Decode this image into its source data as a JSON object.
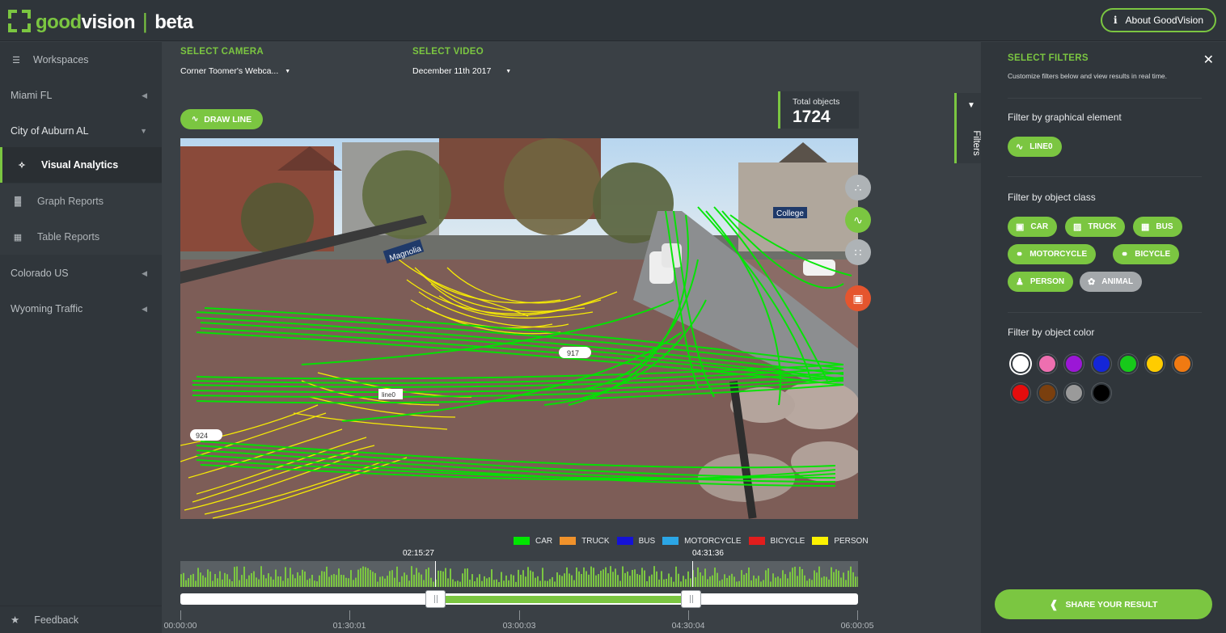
{
  "app": {
    "logo_good": "good",
    "logo_vision": "vision",
    "logo_sep": "|",
    "logo_beta": "beta",
    "about_label": "About GoodVision"
  },
  "sidebar": {
    "items": [
      {
        "label": "Workspaces",
        "icon": "list-icon"
      },
      {
        "label": "Miami FL",
        "icon": "chevron-left-icon"
      },
      {
        "label": "City of Auburn AL",
        "icon": "chevron-down-icon"
      },
      {
        "label": "Visual Analytics",
        "icon": "crosshair-icon"
      },
      {
        "label": "Graph Reports",
        "icon": "bar-chart-icon"
      },
      {
        "label": "Table Reports",
        "icon": "table-icon"
      },
      {
        "label": "Colorado US",
        "icon": "chevron-left-icon"
      },
      {
        "label": "Wyoming Traffic",
        "icon": "chevron-left-icon"
      }
    ],
    "feedback": "Feedback"
  },
  "main": {
    "camera_label": "SELECT CAMERA",
    "camera_value": "Corner Toomer's Webca...",
    "video_label": "SELECT VIDEO",
    "video_value": "December 11th 2017",
    "draw_line": "DRAW LINE",
    "total_label": "Total objects",
    "total_value": "1724",
    "overlay": {
      "count_a": "917",
      "count_b": "924",
      "line_name": "line0",
      "sign_street": "Magnolia",
      "sign_college": "College"
    },
    "legend": [
      {
        "label": "CAR",
        "color": "#00e600"
      },
      {
        "label": "TRUCK",
        "color": "#f0922b"
      },
      {
        "label": "BUS",
        "color": "#1512d6"
      },
      {
        "label": "MOTORCYCLE",
        "color": "#2ba6e6"
      },
      {
        "label": "BICYCLE",
        "color": "#e21d1d"
      },
      {
        "label": "PERSON",
        "color": "#fdf200"
      }
    ],
    "timeline": {
      "marker_start": "02:15:27",
      "marker_end": "04:31:36",
      "ticks": [
        "00:00:00",
        "01:30:01",
        "03:00:03",
        "04:30:04",
        "06:00:05"
      ]
    }
  },
  "filters_tab": {
    "label": "Filters"
  },
  "panel": {
    "title": "SELECT FILTERS",
    "subtitle": "Customize filters below and view results in real time.",
    "graphical_title": "Filter by graphical element",
    "graphical_chips": [
      "LINE0"
    ],
    "class_title": "Filter by object class",
    "class_chips": [
      {
        "label": "CAR",
        "icon": "car-icon",
        "active": true
      },
      {
        "label": "TRUCK",
        "icon": "truck-icon",
        "active": true
      },
      {
        "label": "BUS",
        "icon": "bus-icon",
        "active": true
      },
      {
        "label": "MOTORCYCLE",
        "icon": "motorcycle-icon",
        "active": true
      },
      {
        "label": "BICYCLE",
        "icon": "bicycle-icon",
        "active": true
      },
      {
        "label": "PERSON",
        "icon": "person-icon",
        "active": true
      },
      {
        "label": "ANIMAL",
        "icon": "paw-icon",
        "active": false
      }
    ],
    "color_title": "Filter by object color",
    "colors": [
      "#ffffff",
      "#ee6fb0",
      "#9b17d6",
      "#1426d8",
      "#17c91a",
      "#ffcc00",
      "#f07a12",
      "#e40d0d",
      "#7a3f0e",
      "#9a9a9a",
      "#000000"
    ],
    "share_label": "SHARE YOUR RESULT"
  },
  "colors": {
    "accent": "#7bc641",
    "topbar": "#2f353a",
    "sidebar": "#30363b",
    "main_bg": "#3a4045"
  }
}
